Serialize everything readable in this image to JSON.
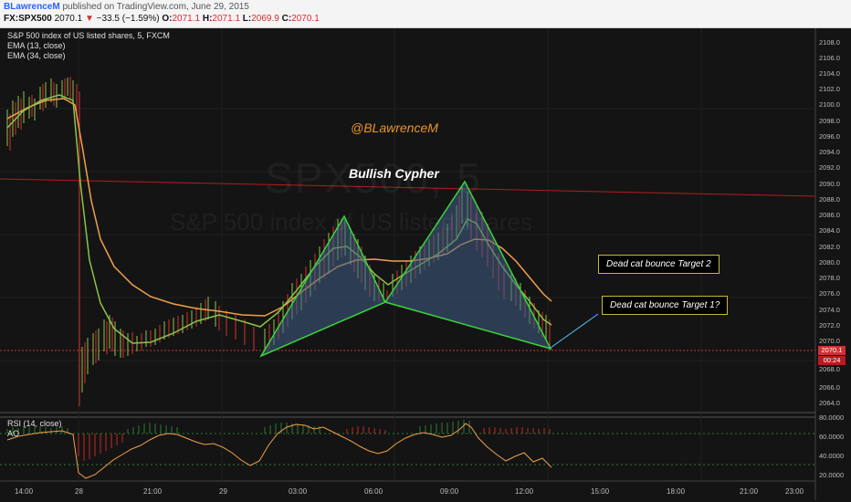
{
  "header": {
    "author": "BLawrenceM",
    "published_text": "published on TradingView.com, June 29, 2015",
    "symbol": "FX:SPX500",
    "last": "2070.1",
    "change": "−33.5 (−1.59%)",
    "open_label": "O:",
    "open": "2071.1",
    "high_label": "H:",
    "high": "2071.1",
    "low_label": "L:",
    "low": "2069.9",
    "close_label": "C:",
    "close": "2070.1"
  },
  "chart_legend": {
    "title": "S&P 500 index of US listed shares, 5, FXCM",
    "ema13": "EMA (13, close)",
    "ema34": "EMA (34, close)"
  },
  "watermark": {
    "symbol": "SPX500, 5",
    "description": "S&P 500 index of US listed shares"
  },
  "annotations": {
    "author_tag": "@BLawrenceM",
    "pattern": "Bullish Cypher",
    "target2": "Dead cat bounce Target 2",
    "target1": "Dead cat bounce Target 1?"
  },
  "price_axis": [
    "2108.0",
    "2106.0",
    "2104.0",
    "2102.0",
    "2100.0",
    "2098.0",
    "2096.0",
    "2094.0",
    "2092.0",
    "2090.0",
    "2088.0",
    "2086.0",
    "2084.0",
    "2082.0",
    "2080.0",
    "2078.0",
    "2076.0",
    "2074.0",
    "2072.0",
    "2070.0",
    "2068.0",
    "2066.0",
    "2064.0"
  ],
  "current_price_badge": "2070.1",
  "countdown_badge": "00:24",
  "sub_panel": {
    "rsi_label": "RSI (14, close)",
    "ao_label": "AO",
    "axis": [
      "80.0000",
      "60.0000",
      "40.0000",
      "20.0000"
    ]
  },
  "time_axis": [
    "14:00",
    "28",
    "21:00",
    "29",
    "03:00",
    "06:00",
    "09:00",
    "12:00",
    "15:00",
    "18:00",
    "21:00",
    "23:00"
  ],
  "colors": {
    "background": "#141414",
    "ema13": "#8bc34a",
    "ema34": "#f0a04b",
    "pattern_fill": "#3f5f86",
    "pattern_edge": "#3bd43b",
    "resistance": "#b71c1c",
    "target_border": "#c9b73b",
    "rsi": "#f0a04b",
    "price_badge": "#d32f2f"
  }
}
